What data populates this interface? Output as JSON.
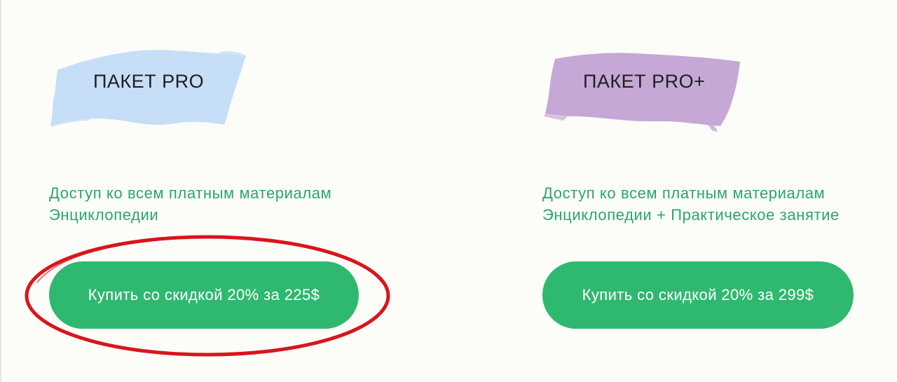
{
  "colors": {
    "background": "#fcfdf9",
    "accent_green": "#2fb870",
    "description_green": "#2aa66a",
    "brush_pro": "#c6def7",
    "brush_proplus": "#c5a8d6",
    "highlight_red": "#d9151c"
  },
  "packages": [
    {
      "title": "ПАКЕТ PRO",
      "description_lines": [
        "Доступ ко всем платным материалам",
        "Энциклопедии"
      ],
      "button_label": "Купить со скидкой 20% за 225$"
    },
    {
      "title": "ПАКЕТ PRO+",
      "description_lines": [
        "Доступ ко всем платным материалам",
        "Энциклопедии + Практическое занятие"
      ],
      "button_label": "Купить со скидкой 20% за 299$"
    }
  ],
  "annotation": {
    "icon": "red-ellipse-highlight"
  }
}
